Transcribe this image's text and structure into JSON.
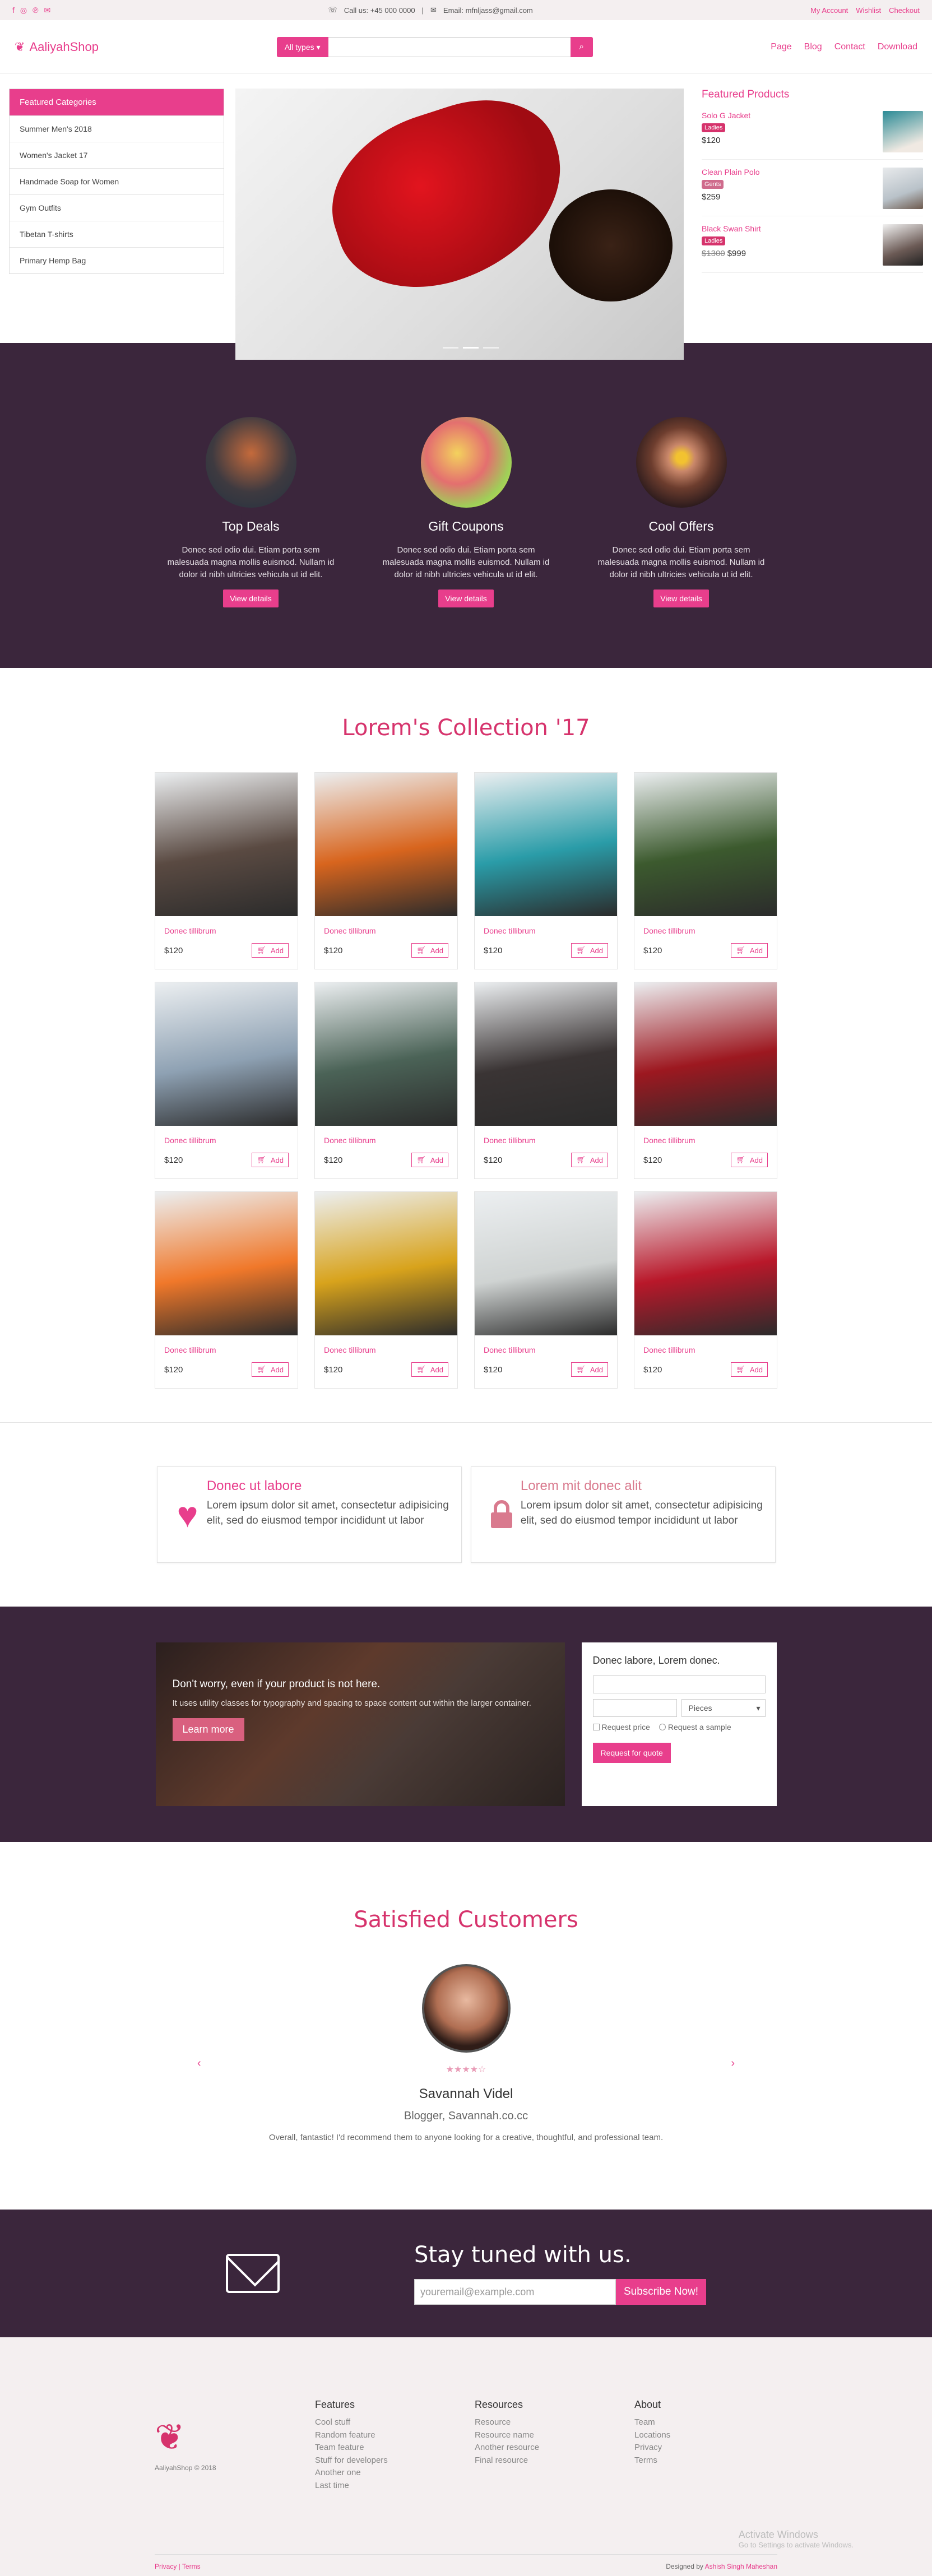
{
  "topbar": {
    "call": "Call us: +45 000 0000",
    "email": "Email: mfnljass@gmail.com",
    "links": [
      "My Account",
      "Wishlist",
      "Checkout"
    ]
  },
  "header": {
    "logo": "AaliyahShop",
    "search_select": "All types",
    "nav": [
      "Page",
      "Blog",
      "Contact",
      "Download"
    ]
  },
  "categories": {
    "title": "Featured Categories",
    "items": [
      "Summer Men's 2018",
      "Women's Jacket 17",
      "Handmade Soap for Women",
      "Gym Outfits",
      "Tibetan T-shirts",
      "Primary Hemp Bag"
    ]
  },
  "featured": {
    "title": "Featured Products",
    "products": [
      {
        "name": "Solo G Jacket",
        "badge": "Ladies",
        "price": "$120",
        "old_price": "",
        "color": "#2a8a95"
      },
      {
        "name": "Clean Plain Polo",
        "badge": "Gents",
        "price": "$259",
        "old_price": "",
        "color": "#b9c2c9"
      },
      {
        "name": "Black Swan Shirt",
        "badge": "Ladies",
        "price": "$999",
        "old_price": "$1300",
        "color": "#6b5a55"
      }
    ]
  },
  "offers": [
    {
      "title": "Top Deals",
      "text": "Donec sed odio dui. Etiam porta sem malesuada magna mollis euismod. Nullam id dolor id nibh ultricies vehicula ut id elit.",
      "button": "View details"
    },
    {
      "title": "Gift Coupons",
      "text": "Donec sed odio dui. Etiam porta sem malesuada magna mollis euismod. Nullam id dolor id nibh ultricies vehicula ut id elit.",
      "button": "View details"
    },
    {
      "title": "Cool Offers",
      "text": "Donec sed odio dui. Etiam porta sem malesuada magna mollis euismod. Nullam id dolor id nibh ultricies vehicula ut id elit.",
      "button": "View details"
    }
  ],
  "collection": {
    "title": "Lorem's Collection '17",
    "products": [
      {
        "name": "Donec tillibrum",
        "price": "$120",
        "add": "Add",
        "color": "#5a4a42"
      },
      {
        "name": "Donec tillibrum",
        "price": "$120",
        "add": "Add",
        "color": "#d8651e"
      },
      {
        "name": "Donec tillibrum",
        "price": "$120",
        "add": "Add",
        "color": "#2a9ca8"
      },
      {
        "name": "Donec tillibrum",
        "price": "$120",
        "add": "Add",
        "color": "#3c5a2e"
      },
      {
        "name": "Donec tillibrum",
        "price": "$120",
        "add": "Add",
        "color": "#8ea1b3"
      },
      {
        "name": "Donec tillibrum",
        "price": "$120",
        "add": "Add",
        "color": "#4b6357"
      },
      {
        "name": "Donec tillibrum",
        "price": "$120",
        "add": "Add",
        "color": "#3a3434"
      },
      {
        "name": "Donec tillibrum",
        "price": "$120",
        "add": "Add",
        "color": "#9d1820"
      },
      {
        "name": "Donec tillibrum",
        "price": "$120",
        "add": "Add",
        "color": "#f0782a"
      },
      {
        "name": "Donec tillibrum",
        "price": "$120",
        "add": "Add",
        "color": "#d8a31c"
      },
      {
        "name": "Donec tillibrum",
        "price": "$120",
        "add": "Add",
        "color": "#cfd3d2"
      },
      {
        "name": "Donec tillibrum",
        "price": "$120",
        "add": "Add",
        "color": "#b9182a"
      }
    ]
  },
  "features": [
    {
      "title": "Donec ut labore",
      "text": "Lorem ipsum dolor sit amet, consectetur adipisicing elit, sed do eiusmod tempor incididunt ut labor",
      "icon": "heart-icon"
    },
    {
      "title": "Lorem mit donec alit",
      "text": "Lorem ipsum dolor sit amet, consectetur adipisicing elit, sed do eiusmod tempor incididunt ut labor",
      "icon": "lock-icon"
    }
  ],
  "quote": {
    "headline": "Don't worry, even if your product is not here.",
    "text": "It uses utility classes for typography and spacing to space content out within the larger container.",
    "learn": "Learn more",
    "form_title": "Donec labore, Lorem donec.",
    "unit": "Pieces",
    "check1": "Request price",
    "check2": "Request a sample",
    "submit": "Request for quote"
  },
  "testimonial": {
    "title": "Satisfied Customers",
    "stars": "★★★★☆",
    "name": "Savannah Videl",
    "role": "Blogger, Savannah.co.cc",
    "text": "Overall, fantastic! I'd recommend them to anyone looking for a creative, thoughtful, and professional team."
  },
  "newsletter": {
    "title": "Stay tuned with us.",
    "placeholder": "youremail@example.com",
    "button": "Subscribe Now!"
  },
  "footer": {
    "copyright": "AaliyahShop © 2018",
    "cols": [
      {
        "title": "Features",
        "items": [
          "Cool stuff",
          "Random feature",
          "Team feature",
          "Stuff for developers",
          "Another one",
          "Last time"
        ]
      },
      {
        "title": "Resources",
        "items": [
          "Resource",
          "Resource name",
          "Another resource",
          "Final resource"
        ]
      },
      {
        "title": "About",
        "items": [
          "Team",
          "Locations",
          "Privacy",
          "Terms"
        ]
      }
    ],
    "legal": "Privacy | Terms",
    "designed_prefix": "Designed by",
    "designer": "Ashish Singh Maheshan"
  },
  "watermark": {
    "title": "Activate Windows",
    "sub": "Go to Settings to activate Windows."
  }
}
